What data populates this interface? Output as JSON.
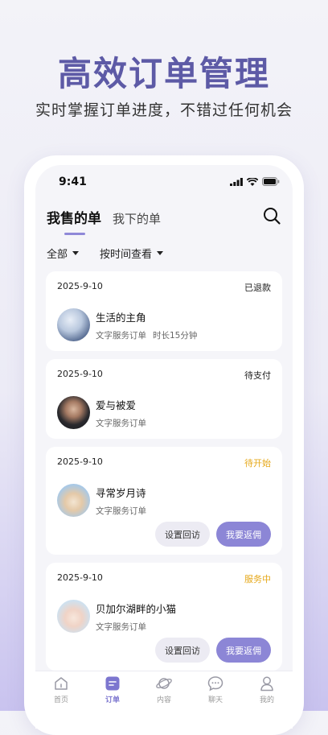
{
  "hero": {
    "title": "高效订单管理",
    "subtitle": "实时掌握订单进度，不错过任何机会"
  },
  "status_bar": {
    "time": "9:41"
  },
  "tabs": [
    {
      "label": "我售的单",
      "active": true
    },
    {
      "label": "我下的单",
      "active": false
    }
  ],
  "filters": {
    "all": "全部",
    "by_time": "按时间查看"
  },
  "orders": [
    {
      "date": "2025-9-10",
      "status": "已退款",
      "status_color": "#222222",
      "title": "生活的主角",
      "type": "文字服务订单",
      "duration": "时长15分钟",
      "avatar": "girl-photo"
    },
    {
      "date": "2025-9-10",
      "status": "待支付",
      "status_color": "#222222",
      "title": "爱与被爱",
      "type": "文字服务订单",
      "avatar": "man-portrait"
    },
    {
      "date": "2025-9-10",
      "status": "待开始",
      "status_color": "#e6a81a",
      "title": "寻常岁月诗",
      "type": "文字服务订单",
      "avatar": "puppy-photo",
      "actions": {
        "secondary": "设置回访",
        "primary": "我要返佣"
      }
    },
    {
      "date": "2025-9-10",
      "status": "服务中",
      "status_color": "#e6a81a",
      "title": "贝加尔湖畔的小猫",
      "type": "文字服务订单",
      "avatar": "cat-photo",
      "actions": {
        "secondary": "设置回访",
        "primary": "我要返佣"
      }
    }
  ],
  "tabbar": [
    {
      "label": "首页",
      "icon": "home-icon"
    },
    {
      "label": "订单",
      "icon": "order-icon",
      "active": true
    },
    {
      "label": "内容",
      "icon": "planet-icon"
    },
    {
      "label": "聊天",
      "icon": "chat-icon"
    },
    {
      "label": "我的",
      "icon": "profile-icon"
    }
  ],
  "colors": {
    "accent": "#8c86d6",
    "hero_title": "#5d5aa6",
    "pending": "#e6a81a"
  }
}
